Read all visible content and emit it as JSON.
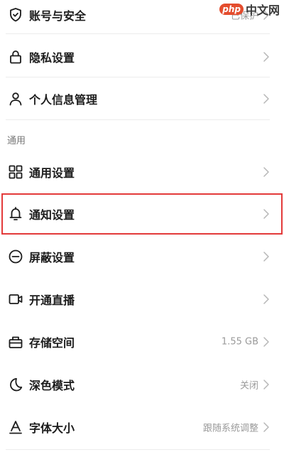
{
  "top_items": [
    {
      "label": "账号与安全",
      "value": "已保护",
      "icon": "shield-check-icon"
    },
    {
      "label": "隐私设置",
      "value": "",
      "icon": "lock-icon"
    },
    {
      "label": "个人信息管理",
      "value": "",
      "icon": "person-icon"
    }
  ],
  "section_general": {
    "title": "通用"
  },
  "general_items": [
    {
      "label": "通用设置",
      "value": "",
      "icon": "grid-icon"
    },
    {
      "label": "通知设置",
      "value": "",
      "icon": "bell-icon"
    },
    {
      "label": "屏蔽设置",
      "value": "",
      "icon": "block-circle-icon"
    },
    {
      "label": "开通直播",
      "value": "",
      "icon": "video-camera-icon"
    },
    {
      "label": "存储空间",
      "value": "1.55 GB",
      "icon": "storage-box-icon"
    },
    {
      "label": "深色模式",
      "value": "关闭",
      "icon": "moon-icon"
    },
    {
      "label": "字体大小",
      "value": "跟随系统调整",
      "icon": "font-a-icon"
    }
  ],
  "watermark": {
    "logo": "php",
    "text": "中文网"
  },
  "colors": {
    "highlight": "#e33a3a",
    "text": "#1c1c1c",
    "secondary": "#9a9a9a"
  }
}
